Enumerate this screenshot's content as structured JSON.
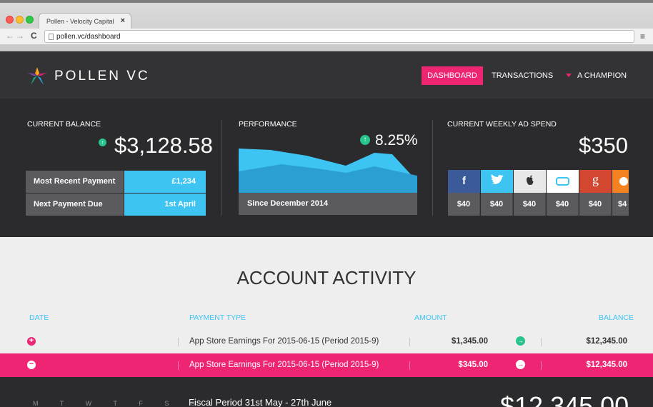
{
  "browser": {
    "tab_title": "Pollen - Velocity Capital",
    "tab_close": "×",
    "url": "pollen.vc/dashboard",
    "back": "←",
    "forward": "→",
    "reload": "C",
    "menu": "≡"
  },
  "header": {
    "brand": "POLLEN VC",
    "nav": {
      "dashboard": "DASHBOARD",
      "transactions": "TRANSACTIONS",
      "user": "A CHAMPION"
    },
    "accent": "#ed2572"
  },
  "balance": {
    "label": "CURRENT BALANCE",
    "value": "$3,128.58",
    "rows": [
      {
        "label": "Most Recent Payment",
        "value": "£1,234"
      },
      {
        "label": "Next Payment Due",
        "value": "1st April"
      }
    ]
  },
  "performance": {
    "label": "PERFORMANCE",
    "value": "8.25%",
    "since": "Since December 2014"
  },
  "ad_spend": {
    "label": "CURRENT WEEKLY AD SPEND",
    "value": "$350",
    "channels": [
      {
        "name": "facebook",
        "glyph": "f",
        "color": "#3b5a99",
        "amount": "$40"
      },
      {
        "name": "twitter",
        "glyph": "t",
        "color": "#3ec4f3",
        "amount": "$40"
      },
      {
        "name": "apple",
        "glyph": "",
        "color": "#e8e8e8",
        "amount": "$40"
      },
      {
        "name": "generic-app",
        "glyph": "",
        "color": "#ffffff",
        "amount": "$40"
      },
      {
        "name": "google",
        "glyph": "g",
        "color": "#d34730",
        "amount": "$40"
      },
      {
        "name": "other",
        "glyph": "",
        "color": "#f58220",
        "amount": "$4"
      }
    ]
  },
  "activity": {
    "title": "ACCOUNT ACTIVITY",
    "columns": {
      "date": "DATE",
      "type": "PAYMENT TYPE",
      "amount": "AMOUNT",
      "balance": "BALANCE"
    },
    "rows": [
      {
        "type": "App Store Earnings For 2015-06-15 (Period 2015-9)",
        "amount": "$1,345.00",
        "balance": "$12,345.00",
        "expanded": false,
        "expand_glyph": "+",
        "arrow": "→"
      },
      {
        "type": "App Store Earnings For 2015-06-15 (Period 2015-9)",
        "amount": "$345.00",
        "balance": "$12,345.00",
        "expanded": true,
        "expand_glyph": "−",
        "arrow": "→"
      }
    ]
  },
  "calendar": {
    "days": "M T W T F S S",
    "period": "Fiscal Period 31st May - 27th June",
    "total": "$12,345.00"
  }
}
